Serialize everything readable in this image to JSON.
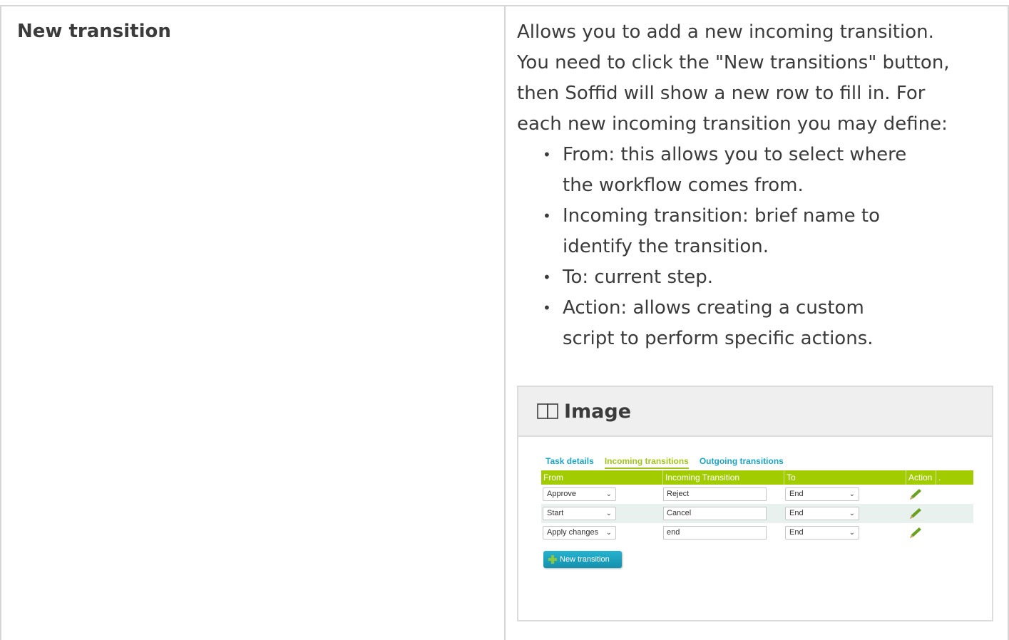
{
  "row": {
    "term": "New transition",
    "description": [
      "Allows you to add a new incoming transition.",
      "You need to click the \"New transitions\" button,",
      "then Soffid will show a new row to fill in. For",
      "each new incoming transition you may define:"
    ],
    "bullets": [
      [
        "From: this allows you to select where",
        "the workflow comes from."
      ],
      [
        "Incoming transition: brief name to",
        "identify the transition."
      ],
      [
        "To: current step."
      ],
      [
        "Action: allows creating a custom",
        "script to perform specific actions."
      ]
    ]
  },
  "image_box": {
    "title": "Image",
    "icon": "image-icon"
  },
  "screenshot": {
    "tabs": [
      "Task details",
      "Incoming transitions",
      "Outgoing transitions"
    ],
    "active_tab": "Incoming transitions",
    "columns": [
      "From",
      "Incoming Transition",
      "To",
      "Action",
      "."
    ],
    "rows": [
      {
        "from": "Approve",
        "transition": "Reject",
        "to": "End"
      },
      {
        "from": "Start",
        "transition": "Cancel",
        "to": "End"
      },
      {
        "from": "Apply changes",
        "transition": "end",
        "to": "End"
      }
    ],
    "new_button_label": "New transition",
    "colors": {
      "accent_green": "#a2cc00",
      "tab_blue": "#1aa4c2",
      "button_blue": "#1fa3c2",
      "plus_green": "#8cc63f",
      "pencil_green": "#6aa121"
    }
  }
}
